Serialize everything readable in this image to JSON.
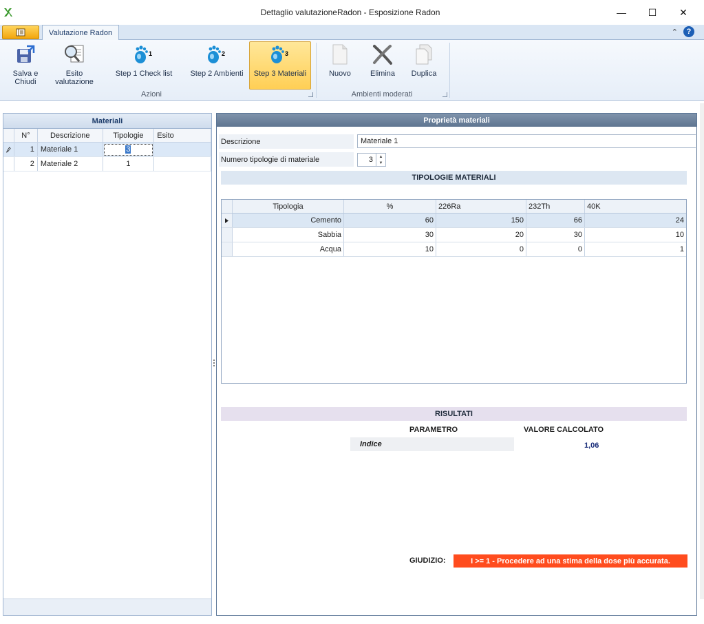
{
  "window": {
    "title": "Dettaglio valutazioneRadon - Esposizione Radon",
    "minimize": "—",
    "maximize": "☐",
    "close": "✕"
  },
  "ribbon": {
    "file_icon": "≡",
    "tab_active": "Valutazione Radon",
    "collapse_icon": "⌃",
    "help": "?",
    "groups": {
      "azioni": "Azioni",
      "ambienti": "Ambienti moderati"
    },
    "buttons": {
      "save_line1": "Salva e",
      "save_line2": "Chiudi",
      "esito_line1": "Esito",
      "esito_line2": "valutazione",
      "step1": "Step 1 Check list",
      "step2": "Step 2 Ambienti",
      "step3": "Step 3 Materiali",
      "nuovo": "Nuovo",
      "elimina": "Elimina",
      "duplica": "Duplica"
    },
    "step_badges": {
      "step1": "1",
      "step2": "2",
      "step3": "3"
    }
  },
  "materiali": {
    "title": "Materiali",
    "columns": {
      "num": "N°",
      "desc": "Descrizione",
      "tip": "Tipologie",
      "esito": "Esito"
    },
    "rows": [
      {
        "num": "1",
        "desc": "Materiale 1",
        "tip": "3",
        "esito": ""
      },
      {
        "num": "2",
        "desc": "Materiale 2",
        "tip": "1",
        "esito": ""
      }
    ]
  },
  "proprieta": {
    "title": "Proprietà materiali",
    "descrizione_label": "Descrizione",
    "descrizione_value": "Materiale 1",
    "numero_label": "Numero tipologie di materiale",
    "numero_value": "3",
    "tipologie_title": "TIPOLOGIE MATERIALI",
    "table": {
      "columns": {
        "tipologia": "Tipologia",
        "pct": "%",
        "ra": "226Ra",
        "th": "232Th",
        "k": "40K"
      },
      "rows": [
        {
          "tipologia": "Cemento",
          "pct": "60",
          "ra": "150",
          "th": "66",
          "k": "24"
        },
        {
          "tipologia": "Sabbia",
          "pct": "30",
          "ra": "20",
          "th": "30",
          "k": "10"
        },
        {
          "tipologia": "Acqua",
          "pct": "10",
          "ra": "0",
          "th": "0",
          "k": "1"
        }
      ]
    },
    "risultati_title": "RISULTATI",
    "parametro_header": "PARAMETRO",
    "valore_header": "VALORE CALCOLATO",
    "indice_label": "Indice",
    "indice_value": "1,06",
    "giudizio_label": "GIUDIZIO:",
    "giudizio_text": "I >= 1 - Procedere ad una stima della dose più accurata.",
    "giudizio_color": "#ff4c1e"
  }
}
